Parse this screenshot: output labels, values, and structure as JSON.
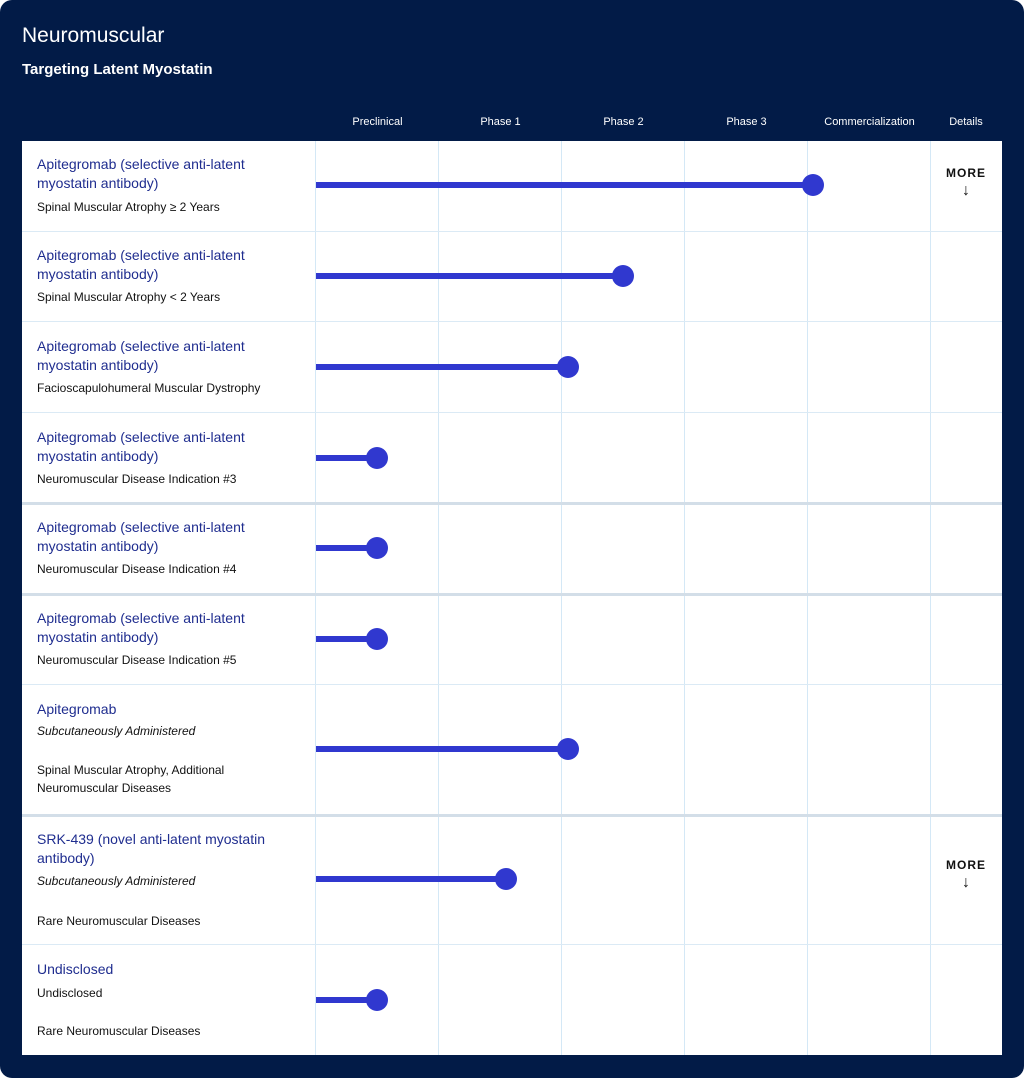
{
  "section": {
    "title": "Neuromuscular",
    "subtitle": "Targeting Latent Myostatin"
  },
  "columns": [
    "Preclinical",
    "Phase 1",
    "Phase 2",
    "Phase 3",
    "Commercialization",
    "Details"
  ],
  "colors": {
    "background": "#021b47",
    "accent": "#3038cf",
    "name_text": "#1f2d8f",
    "grid": "#d4e8f6"
  },
  "programs": [
    {
      "name": "Apitegromab (selective anti-latent myostatin antibody)",
      "note": "",
      "indication": "Spinal Muscular Atrophy ≥ 2 Years",
      "progress": 0.81,
      "more": true
    },
    {
      "name": "Apitegromab (selective anti-latent myostatin antibody)",
      "note": "",
      "indication": "Spinal Muscular Atrophy < 2 Years",
      "progress": 0.5,
      "more": false
    },
    {
      "name": "Apitegromab (selective anti-latent myostatin antibody)",
      "note": "",
      "indication": "Facioscapulohumeral Muscular Dystrophy",
      "progress": 0.41,
      "more": false
    },
    {
      "name": "Apitegromab (selective anti-latent myostatin antibody)",
      "note": "",
      "indication": "Neuromuscular Disease Indication #3",
      "progress": 0.1,
      "more": false
    },
    {
      "name": "Apitegromab (selective anti-latent myostatin antibody)",
      "note": "",
      "indication": "Neuromuscular Disease Indication #4",
      "progress": 0.1,
      "more": false
    },
    {
      "name": "Apitegromab (selective anti-latent myostatin antibody)",
      "note": "",
      "indication": "Neuromuscular Disease Indication #5",
      "progress": 0.1,
      "more": false
    },
    {
      "name": "Apitegromab",
      "note": "Subcutaneously Administered",
      "indication": "Spinal Muscular Atrophy, Additional Neuromuscular Diseases",
      "progress": 0.41,
      "more": false
    },
    {
      "name": "SRK-439 (novel anti-latent myostatin antibody)",
      "note": "Subcutaneously Administered",
      "indication": "Rare Neuromuscular Diseases",
      "progress": 0.31,
      "more": true
    },
    {
      "name": "Undisclosed",
      "note": "Undisclosed",
      "indication": "Rare Neuromuscular Diseases",
      "progress": 0.1,
      "more": false
    }
  ],
  "more": {
    "label": "MORE",
    "arrow": "↓"
  }
}
